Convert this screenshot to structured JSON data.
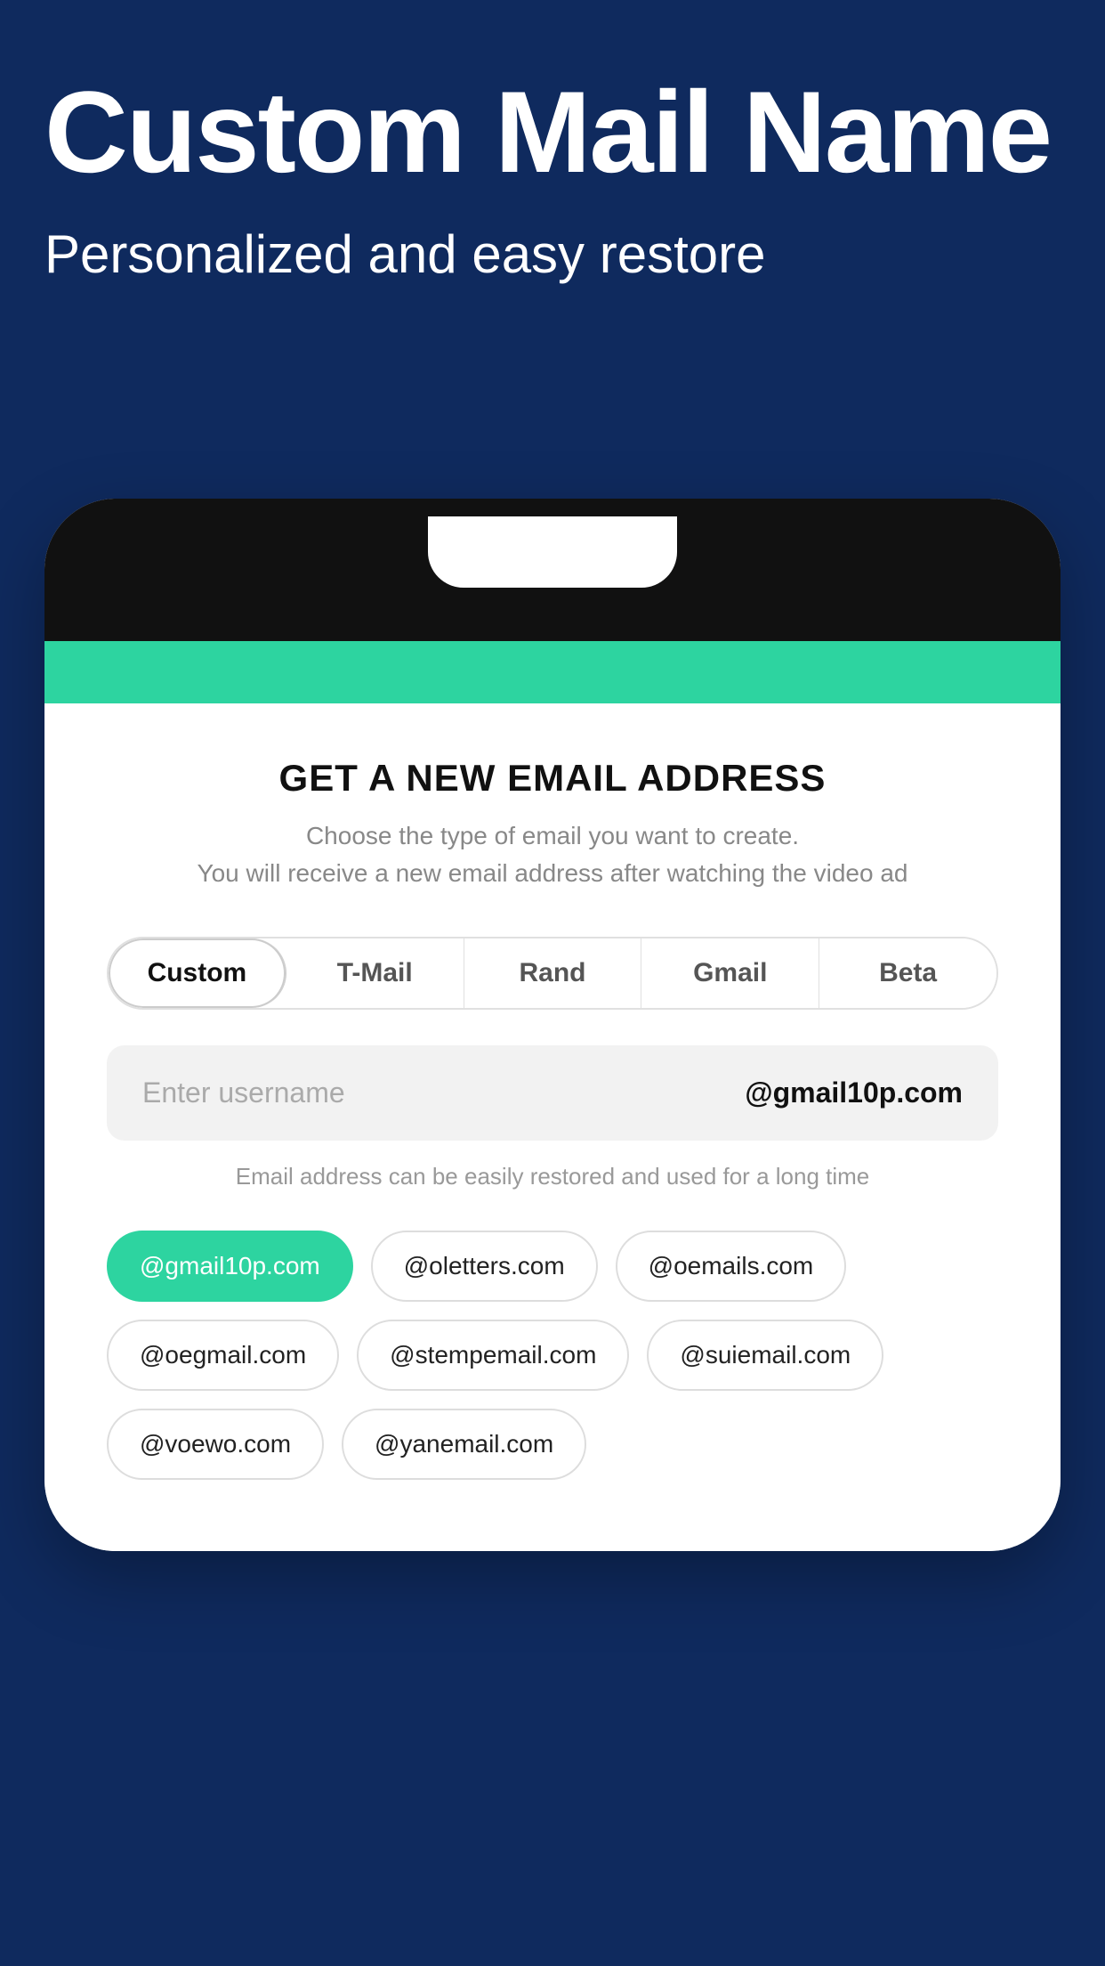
{
  "header": {
    "title": "Custom Mail Name",
    "subtitle": "Personalized and easy restore",
    "bg_color": "#0f2a5e"
  },
  "phone": {
    "teal_color": "#2dd4a0"
  },
  "email_section": {
    "title": "GET A NEW EMAIL ADDRESS",
    "description_line1": "Choose the type of email you want to create.",
    "description_line2": "You will receive a new email address after watching the video ad",
    "tabs": [
      {
        "label": "Custom",
        "active": true
      },
      {
        "label": "T-Mail",
        "active": false
      },
      {
        "label": "Rand",
        "active": false
      },
      {
        "label": "Gmail",
        "active": false
      },
      {
        "label": "Beta",
        "active": false
      }
    ],
    "input": {
      "placeholder": "Enter username",
      "domain": "@gmail10p.com"
    },
    "hint": "Email address can be easily restored and used for a long time",
    "domains": [
      {
        "label": "@gmail10p.com",
        "active": true
      },
      {
        "label": "@oletters.com",
        "active": false
      },
      {
        "label": "@oemails.com",
        "active": false
      },
      {
        "label": "@oegmail.com",
        "active": false
      },
      {
        "label": "@stempemail.com",
        "active": false
      },
      {
        "label": "@suiemail.com",
        "active": false
      },
      {
        "label": "@voewo.com",
        "active": false
      },
      {
        "label": "@yanemail.com",
        "active": false
      }
    ]
  }
}
